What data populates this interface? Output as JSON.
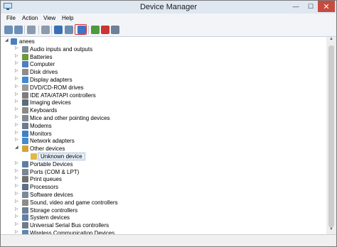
{
  "window": {
    "title": "Device Manager"
  },
  "controls": {
    "minimize": "—",
    "maximize": "☐",
    "close": "✕"
  },
  "menu": [
    "File",
    "Action",
    "View",
    "Help"
  ],
  "tree": {
    "root": "anees",
    "items": [
      {
        "label": "Audio inputs and outputs",
        "icon": "speaker-icon",
        "color": "#7a8a99"
      },
      {
        "label": "Batteries",
        "icon": "battery-icon",
        "color": "#6c9a3d"
      },
      {
        "label": "Computer",
        "icon": "computer-icon",
        "color": "#4a7fc1"
      },
      {
        "label": "Disk drives",
        "icon": "disk-icon",
        "color": "#8d8d8d"
      },
      {
        "label": "Display adapters",
        "icon": "display-icon",
        "color": "#3f8bd1"
      },
      {
        "label": "DVD/CD-ROM drives",
        "icon": "dvd-icon",
        "color": "#9a9a9a"
      },
      {
        "label": "IDE ATA/ATAPI controllers",
        "icon": "controller-icon",
        "color": "#7d7d7d"
      },
      {
        "label": "Imaging devices",
        "icon": "camera-icon",
        "color": "#5a6b7c"
      },
      {
        "label": "Keyboards",
        "icon": "keyboard-icon",
        "color": "#8a8a8a"
      },
      {
        "label": "Mice and other pointing devices",
        "icon": "mouse-icon",
        "color": "#808b96"
      },
      {
        "label": "Modems",
        "icon": "modem-icon",
        "color": "#6d7b8a"
      },
      {
        "label": "Monitors",
        "icon": "monitor-icon",
        "color": "#3f80c8"
      },
      {
        "label": "Network adapters",
        "icon": "network-icon",
        "color": "#4a89c9"
      },
      {
        "label": "Other devices",
        "icon": "other-devices-icon",
        "color": "#d3a23f",
        "expanded": true,
        "children": [
          {
            "label": "Unknown device",
            "icon": "unknown-device-warning-icon",
            "color": "#e0b74a",
            "selected": true
          }
        ]
      },
      {
        "label": "Portable Devices",
        "icon": "portable-device-icon",
        "color": "#5d7fa6"
      },
      {
        "label": "Ports (COM & LPT)",
        "icon": "port-icon",
        "color": "#7a8694"
      },
      {
        "label": "Print queues",
        "icon": "printer-icon",
        "color": "#6f6f6f"
      },
      {
        "label": "Processors",
        "icon": "processor-icon",
        "color": "#5b6f86"
      },
      {
        "label": "Software devices",
        "icon": "software-device-icon",
        "color": "#7a8a9a"
      },
      {
        "label": "Sound, video and game controllers",
        "icon": "sound-icon",
        "color": "#8c8c8c"
      },
      {
        "label": "Storage controllers",
        "icon": "storage-icon",
        "color": "#6c7f95"
      },
      {
        "label": "System devices",
        "icon": "system-device-icon",
        "color": "#5f7fa8"
      },
      {
        "label": "Universal Serial Bus controllers",
        "icon": "usb-icon",
        "color": "#717c88"
      },
      {
        "label": "Wireless Communication Devices",
        "icon": "wireless-icon",
        "color": "#5c86b5"
      }
    ]
  },
  "toolbar": [
    {
      "name": "back-icon",
      "color": "#6b8fb8"
    },
    {
      "name": "forward-icon",
      "color": "#6b8fb8"
    },
    {
      "name": "properties-view-icon",
      "color": "#8a9bb0"
    },
    {
      "name": "tree-view-icon",
      "color": "#8a9bb0"
    },
    {
      "name": "help-icon",
      "color": "#3a6fb7"
    },
    {
      "name": "details-icon",
      "color": "#6d8db0"
    },
    {
      "name": "scan-hardware-icon",
      "color": "#3f74c6"
    },
    {
      "name": "update-driver-icon",
      "color": "#4d9a3e"
    },
    {
      "name": "disable-device-icon",
      "color": "#cc3333"
    },
    {
      "name": "uninstall-icon",
      "color": "#6d7f99"
    }
  ]
}
